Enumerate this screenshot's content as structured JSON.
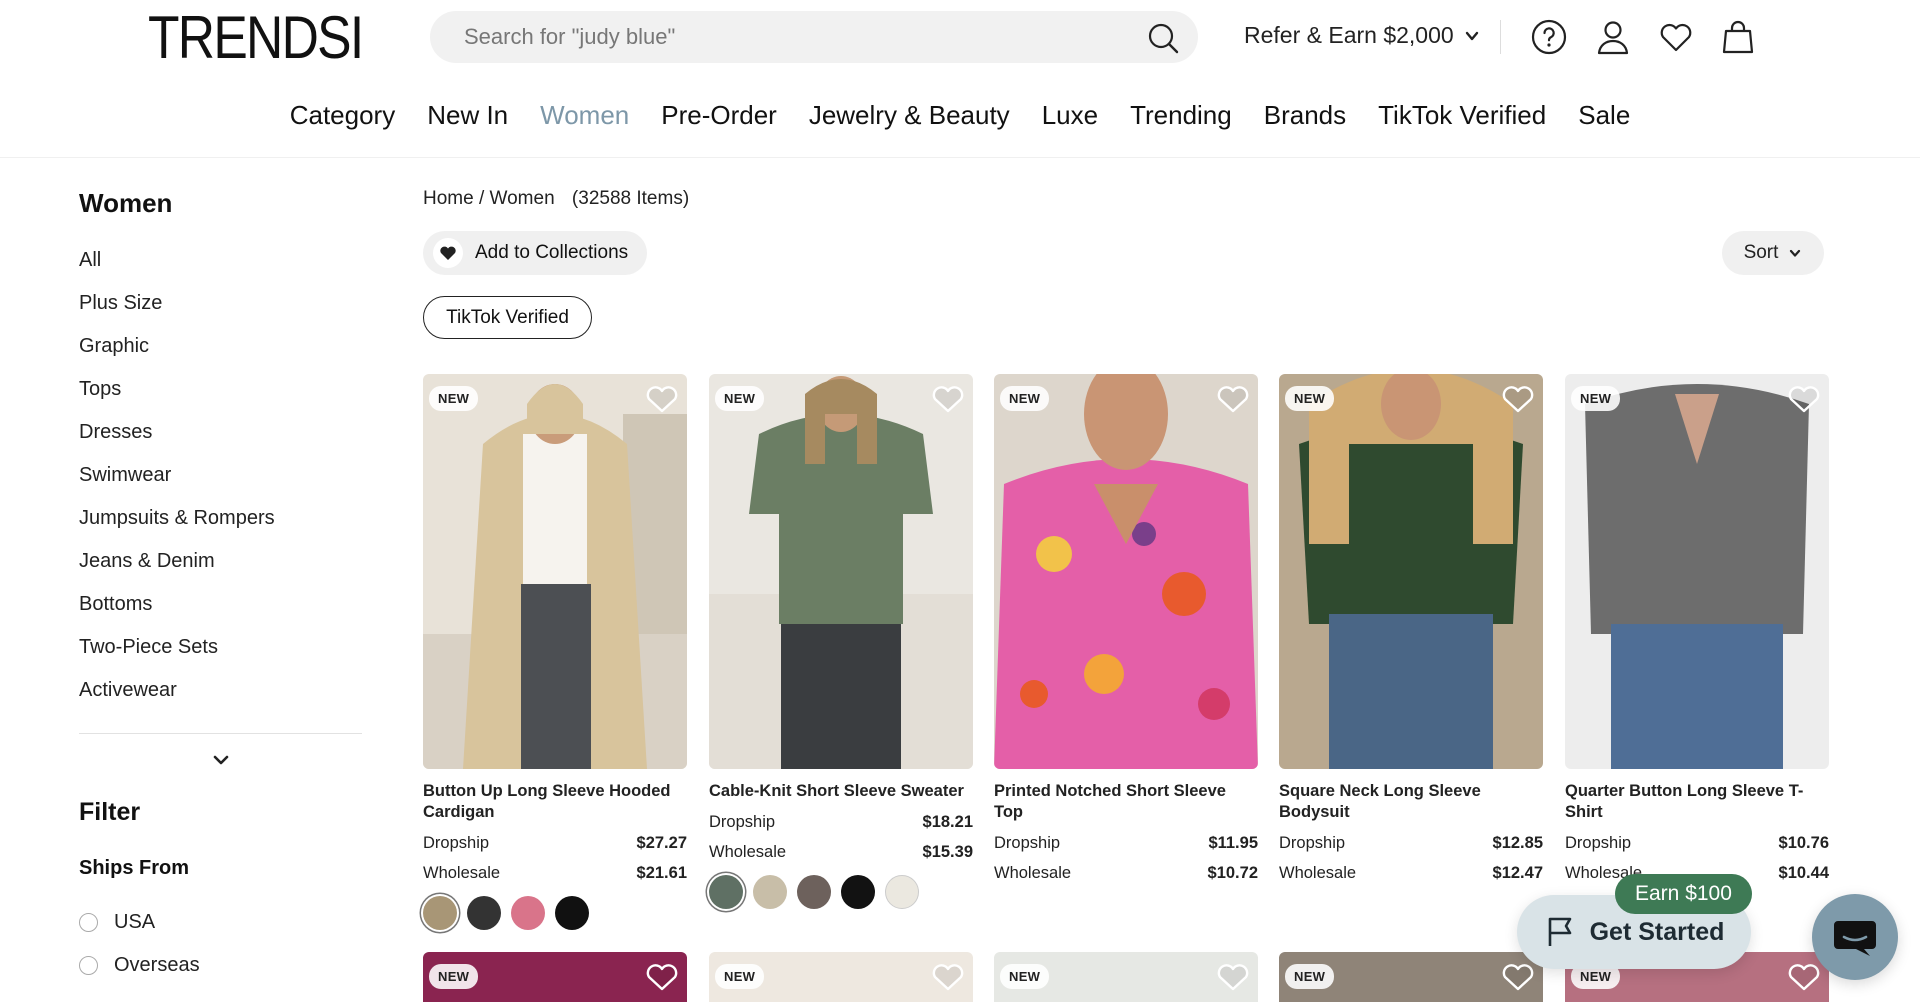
{
  "header": {
    "logo": "TRENDSI",
    "search_placeholder": "Search for \"judy blue\"",
    "refer_label": "Refer & Earn $2,000"
  },
  "nav": [
    "Category",
    "New In",
    "Women",
    "Pre-Order",
    "Jewelry & Beauty",
    "Luxe",
    "Trending",
    "Brands",
    "TikTok Verified",
    "Sale"
  ],
  "nav_active": "Women",
  "sidebar": {
    "title": "Women",
    "items": [
      "All",
      "Plus Size",
      "Graphic",
      "Tops",
      "Dresses",
      "Swimwear",
      "Jumpsuits & Rompers",
      "Jeans & Denim",
      "Bottoms",
      "Two-Piece Sets",
      "Activewear"
    ],
    "filter_title": "Filter",
    "ships_from_title": "Ships From",
    "ships_from_options": [
      "USA",
      "Overseas"
    ]
  },
  "main": {
    "breadcrumb": "Home / Women",
    "item_count": "(32588 Items)",
    "add_collections": "Add to Collections",
    "sort": "Sort",
    "chip": "TikTok Verified",
    "badge": "NEW",
    "dropship_label": "Dropship",
    "wholesale_label": "Wholesale",
    "products": [
      {
        "name": "Button Up Long Sleeve Hooded Cardigan",
        "dropship": "$27.27",
        "wholesale": "$21.61",
        "swatches": [
          "#a89676",
          "#333333",
          "#d9748a",
          "#111111"
        ],
        "selected": 0
      },
      {
        "name": "Cable-Knit Short Sleeve Sweater",
        "dropship": "$18.21",
        "wholesale": "$15.39",
        "swatches": [
          "#5f7064",
          "#c8bea8",
          "#6d615c",
          "#121212",
          "#ebe8e0"
        ],
        "selected": 0
      },
      {
        "name": "Printed Notched Short Sleeve Top",
        "dropship": "$11.95",
        "wholesale": "$10.72",
        "swatches": [],
        "selected": -1
      },
      {
        "name": "Square Neck Long Sleeve Bodysuit",
        "dropship": "$12.85",
        "wholesale": "$12.47",
        "swatches": [],
        "selected": -1
      },
      {
        "name": "Quarter Button Long Sleeve T-Shirt",
        "dropship": "$10.76",
        "wholesale": "$10.44",
        "swatches": [],
        "selected": -1
      }
    ]
  },
  "floating": {
    "earn": "Earn $100",
    "get_started": "Get Started"
  },
  "colors": {
    "nav_active": "#7d97a8",
    "earn_bg": "#3e7a55",
    "chat_bg": "#7e9aaa",
    "get_started_bg": "#d9e3e7"
  }
}
